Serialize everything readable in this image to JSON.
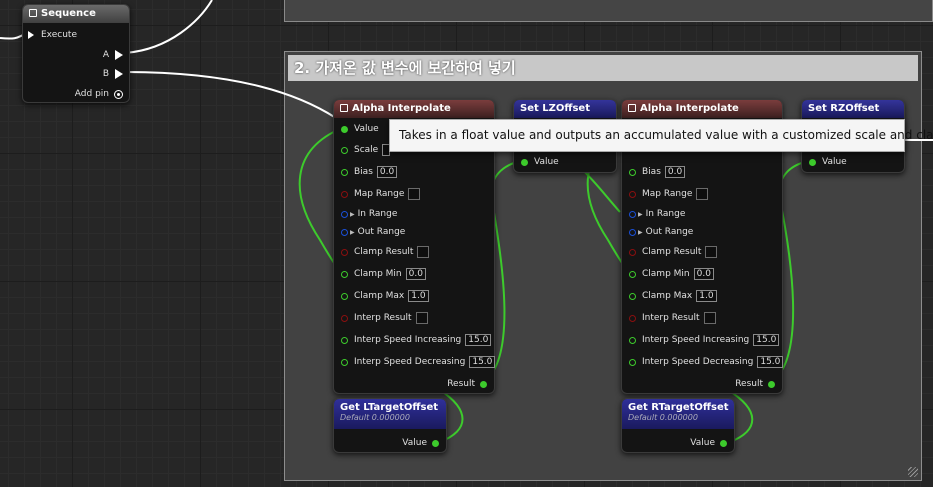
{
  "comment": {
    "title": "2. 가져온 값 변수에 보간하여 넣기"
  },
  "sequence": {
    "title": "Sequence",
    "execute": "Execute",
    "pin_a": "A",
    "pin_b": "B",
    "add_pin": "Add pin"
  },
  "alpha1": {
    "title": "Alpha Interpolate",
    "value": "Value",
    "scale": "Scale",
    "bias": "Bias",
    "bias_val": "0.0",
    "map_range": "Map Range",
    "in_range": "In Range",
    "out_range": "Out Range",
    "clamp_result": "Clamp Result",
    "clamp_min": "Clamp Min",
    "clamp_min_val": "0.0",
    "clamp_max": "Clamp Max",
    "clamp_max_val": "1.0",
    "interp_result": "Interp Result",
    "interp_inc": "Interp Speed Increasing",
    "interp_inc_val": "15.0",
    "interp_dec": "Interp Speed Decreasing",
    "interp_dec_val": "15.0",
    "result": "Result"
  },
  "alpha2": {
    "title": "Alpha Interpolate",
    "bias": "Bias",
    "bias_val": "0.0",
    "map_range": "Map Range",
    "in_range": "In Range",
    "out_range": "Out Range",
    "clamp_result": "Clamp Result",
    "clamp_min": "Clamp Min",
    "clamp_min_val": "0.0",
    "clamp_max": "Clamp Max",
    "clamp_max_val": "1.0",
    "interp_result": "Interp Result",
    "interp_inc": "Interp Speed Increasing",
    "interp_inc_val": "15.0",
    "interp_dec": "Interp Speed Decreasing",
    "interp_dec_val": "15.0",
    "result": "Result"
  },
  "set_l": {
    "title": "Set LZOffset",
    "value": "Value"
  },
  "set_r": {
    "title": "Set RZOffset",
    "value": "Value"
  },
  "get_l": {
    "title": "Get LTargetOffset",
    "default": "Default 0.000000",
    "value": "Value"
  },
  "get_r": {
    "title": "Get RTargetOffset",
    "default": "Default 0.000000",
    "value": "Value"
  },
  "tooltip": {
    "text": "Takes in a float value and outputs an accumulated value with a customized scale and clamp"
  },
  "colors": {
    "float_pin": "#3dcb2c",
    "bool_pin": "#8a0f0f",
    "struct_pin": "#1a50d8",
    "function_header": "#7a3d3d",
    "variable_header": "#34349a"
  },
  "icons": {
    "sequence": "sequence-icon",
    "function": "function-icon",
    "exec": "exec-pin-icon",
    "add": "add-pin-icon"
  }
}
